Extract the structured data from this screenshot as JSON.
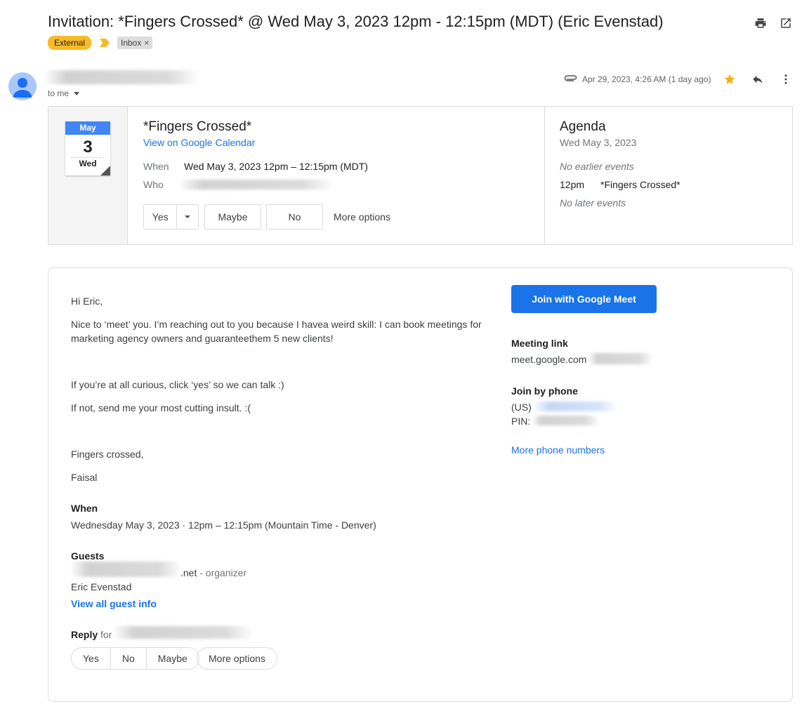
{
  "subject": "Invitation: *Fingers Crossed* @ Wed May 3, 2023 12pm - 12:15pm (MDT) (Eric Evenstad)",
  "labels": {
    "external": "External",
    "inbox": "Inbox",
    "inbox_remove": "×"
  },
  "colors": {
    "external_label": "#f6bb26",
    "primary_blue": "#1a73e8",
    "star": "#f4b400",
    "calendar_blue": "#4285f4"
  },
  "header_icons": [
    "print-icon",
    "open-in-new-window-icon"
  ],
  "sender": {
    "to": "to me",
    "date": "Apr 29, 2023, 4:26 AM (1 day ago)",
    "icons": [
      "attachment-icon",
      "star-icon",
      "reply-icon",
      "more-vert-icon"
    ]
  },
  "invite": {
    "cal_month": "May",
    "cal_day": "3",
    "cal_weekday": "Wed",
    "title": "*Fingers Crossed*",
    "view_link": "View on Google Calendar",
    "when_label": "When",
    "when_value": "Wed May 3, 2023 12pm – 12:15pm (MDT)",
    "who_label": "Who",
    "buttons": {
      "yes": "Yes",
      "maybe": "Maybe",
      "no": "No",
      "more": "More options"
    }
  },
  "agenda": {
    "title": "Agenda",
    "date": "Wed May 3, 2023",
    "earlier": "No earlier events",
    "event_time": "12pm",
    "event_name": "*Fingers Crossed*",
    "later": "No later events"
  },
  "body": {
    "greeting": "Hi Eric,",
    "para1": "Nice to ‘meet’ you. I’m reaching out to you because I havea weird skill: I can book meetings for marketing agency owners and guaranteethem 5 new clients!",
    "para2": "If you’re at all curious, click ‘yes’ so we can talk :)",
    "para3": "If not, send me your most cutting insult. :(",
    "signoff": "Fingers crossed,",
    "name": "Faisal",
    "when_heading": "When",
    "when_detail": "Wednesday May 3, 2023 · 12pm – 12:15pm (Mountain Time - Denver)",
    "guests_heading": "Guests",
    "guest1_suffix": ".net",
    "guest1_role": " - organizer",
    "guest2": "Eric Evenstad",
    "view_all": "View all guest info",
    "reply_label": "Reply",
    "reply_for": " for",
    "reply_buttons": {
      "yes": "Yes",
      "no": "No",
      "maybe": "Maybe",
      "more": "More options"
    }
  },
  "meet": {
    "join_button": "Join with Google Meet",
    "link_heading": "Meeting link",
    "link_value": "meet.google.com",
    "phone_heading": "Join by phone",
    "phone_prefix": "(US)",
    "pin_prefix": "PIN:",
    "more_numbers": "More phone numbers"
  }
}
